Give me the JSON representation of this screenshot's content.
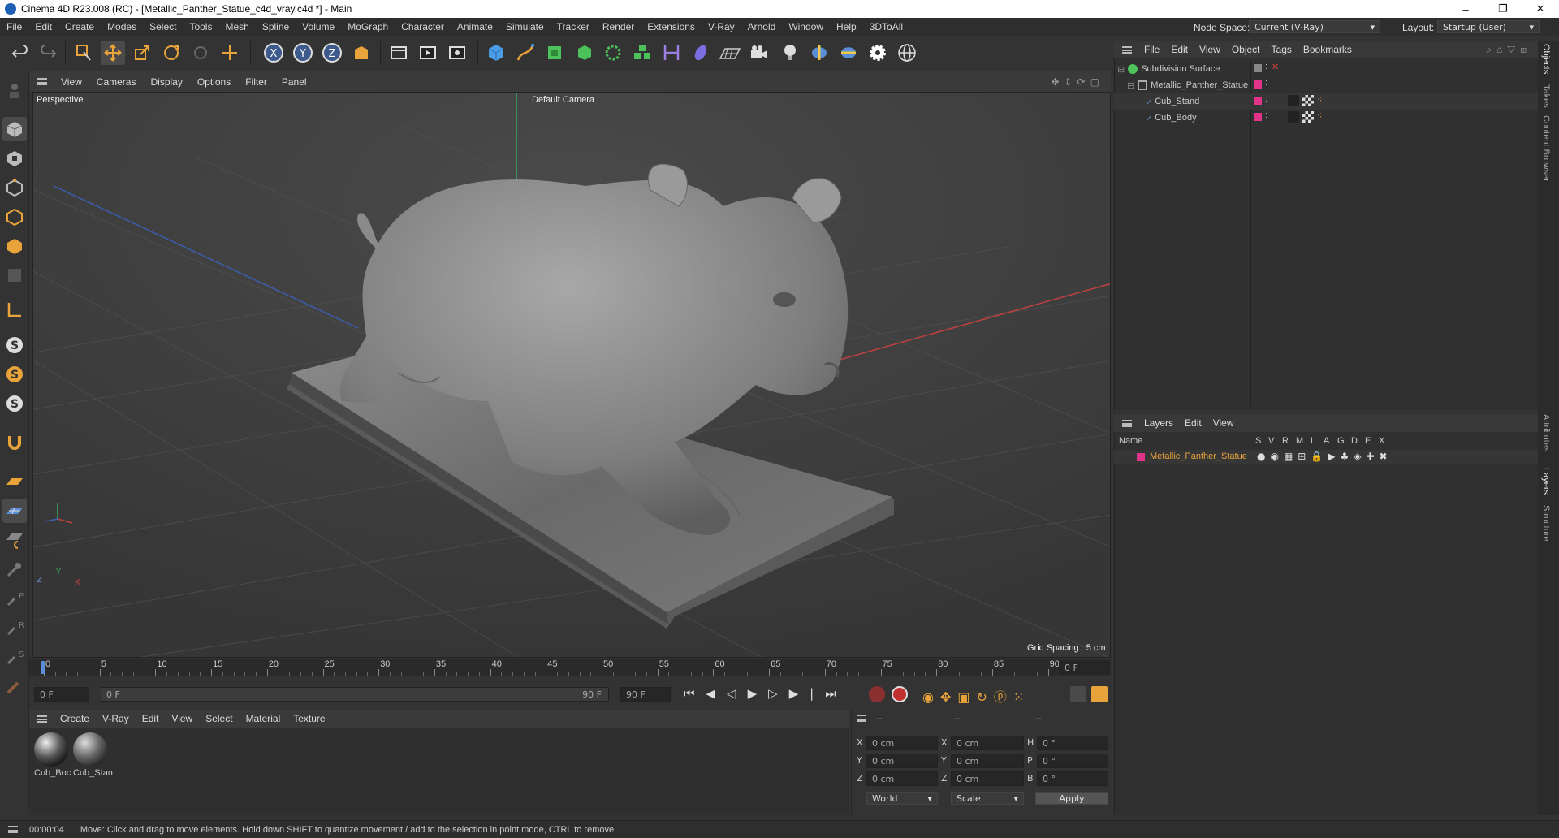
{
  "window": {
    "title": "Cinema 4D R23.008 (RC) - [Metallic_Panther_Statue_c4d_vray.c4d *] - Main",
    "controls": [
      "–",
      "❐",
      "✕"
    ]
  },
  "menubar": {
    "items": [
      "File",
      "Edit",
      "Create",
      "Modes",
      "Select",
      "Tools",
      "Mesh",
      "Spline",
      "Volume",
      "MoGraph",
      "Character",
      "Animate",
      "Simulate",
      "Tracker",
      "Render",
      "Extensions",
      "V-Ray",
      "Arnold",
      "Window",
      "Help",
      "3DToAll"
    ],
    "node_space_label": "Node Space:",
    "node_space_value": "Current (V-Ray)",
    "layout_label": "Layout:",
    "layout_value": "Startup (User)"
  },
  "toolbar": {
    "icons": [
      "undo-icon",
      "redo-icon",
      "live-select-icon",
      "move-icon",
      "scale-icon",
      "rotate-icon",
      "recent-tool-icon",
      "axis-icon",
      "x-axis-icon",
      "y-axis-icon",
      "z-axis-icon",
      "coordinate-system-icon",
      "render-region-icon",
      "render-view-icon",
      "render-settings-icon",
      "cube-icon",
      "pen-icon",
      "subdivision-icon",
      "extrude-icon",
      "cloner-icon",
      "mograph-icon",
      "deformer-icon",
      "field-icon",
      "floor-icon",
      "camera-icon",
      "light-icon",
      "python-icon",
      "python2-icon",
      "settings-icon",
      "vray-icon"
    ]
  },
  "viewport": {
    "menu": [
      "View",
      "Cameras",
      "Display",
      "Options",
      "Filter",
      "Panel"
    ],
    "view_name": "Perspective",
    "camera_name": "Default Camera",
    "grid_spacing": "Grid Spacing : 5 cm",
    "axis": {
      "x": "X",
      "y": "Y",
      "z": "Z"
    }
  },
  "timeline": {
    "ticks": [
      "0",
      "5",
      "10",
      "15",
      "20",
      "25",
      "30",
      "35",
      "40",
      "45",
      "50",
      "55",
      "60",
      "65",
      "70",
      "75",
      "80",
      "85",
      "90"
    ],
    "current_frame_right": "0 F",
    "start_field": "0 F",
    "range_start": "0 F",
    "range_end": "90 F",
    "end_field": "90 F"
  },
  "materials": {
    "menu": [
      "Create",
      "V-Ray",
      "Edit",
      "View",
      "Select",
      "Material",
      "Texture"
    ],
    "items": [
      {
        "label": "Cub_Boc"
      },
      {
        "label": "Cub_Stan"
      }
    ]
  },
  "coords": {
    "headers": [
      "--",
      "--",
      "--"
    ],
    "rows": [
      {
        "a": "X",
        "av": "0 cm",
        "b": "X",
        "bv": "0 cm",
        "c": "H",
        "cv": "0 °"
      },
      {
        "a": "Y",
        "av": "0 cm",
        "b": "Y",
        "bv": "0 cm",
        "c": "P",
        "cv": "0 °"
      },
      {
        "a": "Z",
        "av": "0 cm",
        "b": "Z",
        "bv": "0 cm",
        "c": "B",
        "cv": "0 °"
      }
    ],
    "space": "World",
    "mode": "Scale",
    "apply": "Apply"
  },
  "objects": {
    "menu": [
      "File",
      "Edit",
      "View",
      "Object",
      "Tags",
      "Bookmarks"
    ],
    "tree": [
      {
        "name": "Subdivision Surface",
        "color": "#ffffff"
      },
      {
        "name": "Metallic_Panther_Statue",
        "color": "#ffffff"
      },
      {
        "name": "Cub_Stand",
        "color": "#ffffff"
      },
      {
        "name": "Cub_Body",
        "color": "#ffffff"
      }
    ]
  },
  "layers": {
    "menu": [
      "Layers",
      "Edit",
      "View"
    ],
    "columns": {
      "name": "Name",
      "flags": [
        "S",
        "V",
        "R",
        "M",
        "L",
        "A",
        "G",
        "D",
        "E",
        "X"
      ]
    },
    "rows": [
      {
        "name": "Metallic_Panther_Statue",
        "color": "#e0338a"
      }
    ]
  },
  "sidetabs": [
    "Objects",
    "Takes",
    "Content Browser",
    "Attributes",
    "Layers",
    "Structure"
  ],
  "status": {
    "time": "00:00:04",
    "message": "Move: Click and drag to move elements. Hold down SHIFT to quantize movement / add to the selection in point mode, CTRL to remove."
  },
  "colors": {
    "accent": "#e8a33a",
    "layer": "#e0338a",
    "selection_blue": "#4b7bd6"
  }
}
